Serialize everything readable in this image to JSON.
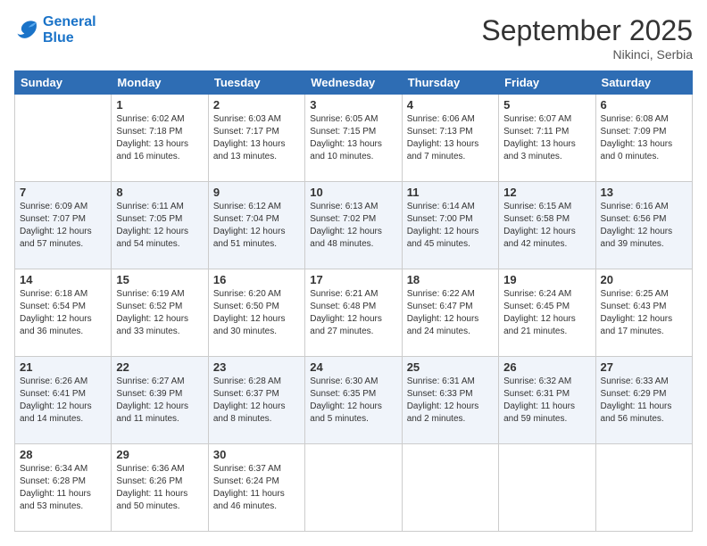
{
  "logo": {
    "line1": "General",
    "line2": "Blue"
  },
  "header": {
    "month": "September 2025",
    "location": "Nikinci, Serbia"
  },
  "weekdays": [
    "Sunday",
    "Monday",
    "Tuesday",
    "Wednesday",
    "Thursday",
    "Friday",
    "Saturday"
  ],
  "weeks": [
    [
      {
        "day": "",
        "sunrise": "",
        "sunset": "",
        "daylight": ""
      },
      {
        "day": "1",
        "sunrise": "Sunrise: 6:02 AM",
        "sunset": "Sunset: 7:18 PM",
        "daylight": "Daylight: 13 hours and 16 minutes."
      },
      {
        "day": "2",
        "sunrise": "Sunrise: 6:03 AM",
        "sunset": "Sunset: 7:17 PM",
        "daylight": "Daylight: 13 hours and 13 minutes."
      },
      {
        "day": "3",
        "sunrise": "Sunrise: 6:05 AM",
        "sunset": "Sunset: 7:15 PM",
        "daylight": "Daylight: 13 hours and 10 minutes."
      },
      {
        "day": "4",
        "sunrise": "Sunrise: 6:06 AM",
        "sunset": "Sunset: 7:13 PM",
        "daylight": "Daylight: 13 hours and 7 minutes."
      },
      {
        "day": "5",
        "sunrise": "Sunrise: 6:07 AM",
        "sunset": "Sunset: 7:11 PM",
        "daylight": "Daylight: 13 hours and 3 minutes."
      },
      {
        "day": "6",
        "sunrise": "Sunrise: 6:08 AM",
        "sunset": "Sunset: 7:09 PM",
        "daylight": "Daylight: 13 hours and 0 minutes."
      }
    ],
    [
      {
        "day": "7",
        "sunrise": "Sunrise: 6:09 AM",
        "sunset": "Sunset: 7:07 PM",
        "daylight": "Daylight: 12 hours and 57 minutes."
      },
      {
        "day": "8",
        "sunrise": "Sunrise: 6:11 AM",
        "sunset": "Sunset: 7:05 PM",
        "daylight": "Daylight: 12 hours and 54 minutes."
      },
      {
        "day": "9",
        "sunrise": "Sunrise: 6:12 AM",
        "sunset": "Sunset: 7:04 PM",
        "daylight": "Daylight: 12 hours and 51 minutes."
      },
      {
        "day": "10",
        "sunrise": "Sunrise: 6:13 AM",
        "sunset": "Sunset: 7:02 PM",
        "daylight": "Daylight: 12 hours and 48 minutes."
      },
      {
        "day": "11",
        "sunrise": "Sunrise: 6:14 AM",
        "sunset": "Sunset: 7:00 PM",
        "daylight": "Daylight: 12 hours and 45 minutes."
      },
      {
        "day": "12",
        "sunrise": "Sunrise: 6:15 AM",
        "sunset": "Sunset: 6:58 PM",
        "daylight": "Daylight: 12 hours and 42 minutes."
      },
      {
        "day": "13",
        "sunrise": "Sunrise: 6:16 AM",
        "sunset": "Sunset: 6:56 PM",
        "daylight": "Daylight: 12 hours and 39 minutes."
      }
    ],
    [
      {
        "day": "14",
        "sunrise": "Sunrise: 6:18 AM",
        "sunset": "Sunset: 6:54 PM",
        "daylight": "Daylight: 12 hours and 36 minutes."
      },
      {
        "day": "15",
        "sunrise": "Sunrise: 6:19 AM",
        "sunset": "Sunset: 6:52 PM",
        "daylight": "Daylight: 12 hours and 33 minutes."
      },
      {
        "day": "16",
        "sunrise": "Sunrise: 6:20 AM",
        "sunset": "Sunset: 6:50 PM",
        "daylight": "Daylight: 12 hours and 30 minutes."
      },
      {
        "day": "17",
        "sunrise": "Sunrise: 6:21 AM",
        "sunset": "Sunset: 6:48 PM",
        "daylight": "Daylight: 12 hours and 27 minutes."
      },
      {
        "day": "18",
        "sunrise": "Sunrise: 6:22 AM",
        "sunset": "Sunset: 6:47 PM",
        "daylight": "Daylight: 12 hours and 24 minutes."
      },
      {
        "day": "19",
        "sunrise": "Sunrise: 6:24 AM",
        "sunset": "Sunset: 6:45 PM",
        "daylight": "Daylight: 12 hours and 21 minutes."
      },
      {
        "day": "20",
        "sunrise": "Sunrise: 6:25 AM",
        "sunset": "Sunset: 6:43 PM",
        "daylight": "Daylight: 12 hours and 17 minutes."
      }
    ],
    [
      {
        "day": "21",
        "sunrise": "Sunrise: 6:26 AM",
        "sunset": "Sunset: 6:41 PM",
        "daylight": "Daylight: 12 hours and 14 minutes."
      },
      {
        "day": "22",
        "sunrise": "Sunrise: 6:27 AM",
        "sunset": "Sunset: 6:39 PM",
        "daylight": "Daylight: 12 hours and 11 minutes."
      },
      {
        "day": "23",
        "sunrise": "Sunrise: 6:28 AM",
        "sunset": "Sunset: 6:37 PM",
        "daylight": "Daylight: 12 hours and 8 minutes."
      },
      {
        "day": "24",
        "sunrise": "Sunrise: 6:30 AM",
        "sunset": "Sunset: 6:35 PM",
        "daylight": "Daylight: 12 hours and 5 minutes."
      },
      {
        "day": "25",
        "sunrise": "Sunrise: 6:31 AM",
        "sunset": "Sunset: 6:33 PM",
        "daylight": "Daylight: 12 hours and 2 minutes."
      },
      {
        "day": "26",
        "sunrise": "Sunrise: 6:32 AM",
        "sunset": "Sunset: 6:31 PM",
        "daylight": "Daylight: 11 hours and 59 minutes."
      },
      {
        "day": "27",
        "sunrise": "Sunrise: 6:33 AM",
        "sunset": "Sunset: 6:29 PM",
        "daylight": "Daylight: 11 hours and 56 minutes."
      }
    ],
    [
      {
        "day": "28",
        "sunrise": "Sunrise: 6:34 AM",
        "sunset": "Sunset: 6:28 PM",
        "daylight": "Daylight: 11 hours and 53 minutes."
      },
      {
        "day": "29",
        "sunrise": "Sunrise: 6:36 AM",
        "sunset": "Sunset: 6:26 PM",
        "daylight": "Daylight: 11 hours and 50 minutes."
      },
      {
        "day": "30",
        "sunrise": "Sunrise: 6:37 AM",
        "sunset": "Sunset: 6:24 PM",
        "daylight": "Daylight: 11 hours and 46 minutes."
      },
      {
        "day": "",
        "sunrise": "",
        "sunset": "",
        "daylight": ""
      },
      {
        "day": "",
        "sunrise": "",
        "sunset": "",
        "daylight": ""
      },
      {
        "day": "",
        "sunrise": "",
        "sunset": "",
        "daylight": ""
      },
      {
        "day": "",
        "sunrise": "",
        "sunset": "",
        "daylight": ""
      }
    ]
  ]
}
